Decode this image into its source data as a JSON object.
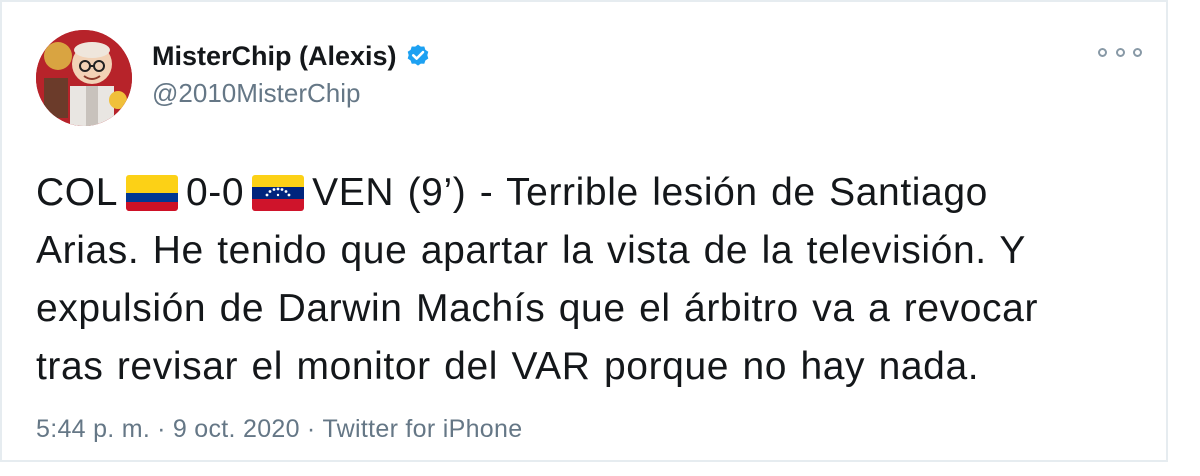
{
  "user": {
    "display_name": "MisterChip (Alexis)",
    "handle": "@2010MisterChip",
    "verified": true
  },
  "tweet": {
    "segments": {
      "team1": "COL",
      "flag1": "colombia-flag",
      "score": "0-0",
      "flag2": "venezuela-flag",
      "line1_rest": "VEN (9’) - Terrible lesión de Santiago",
      "line2": "Arias. He tenido que apartar la vista de la televisión. Y",
      "line3": "expulsión de Darwin Machís que el árbitro va a revocar",
      "line4": "tras revisar el monitor del VAR porque no hay nada."
    }
  },
  "meta": {
    "time": "5:44 p. m.",
    "date": "9 oct. 2020",
    "source": "Twitter for iPhone",
    "separator": "·"
  },
  "icons": {
    "verified": "verified-badge-icon",
    "more": "more-options-icon"
  },
  "colors": {
    "verified_blue": "#1da1f2",
    "text": "#14171a",
    "secondary": "#657786",
    "border": "#e6ecf0"
  }
}
